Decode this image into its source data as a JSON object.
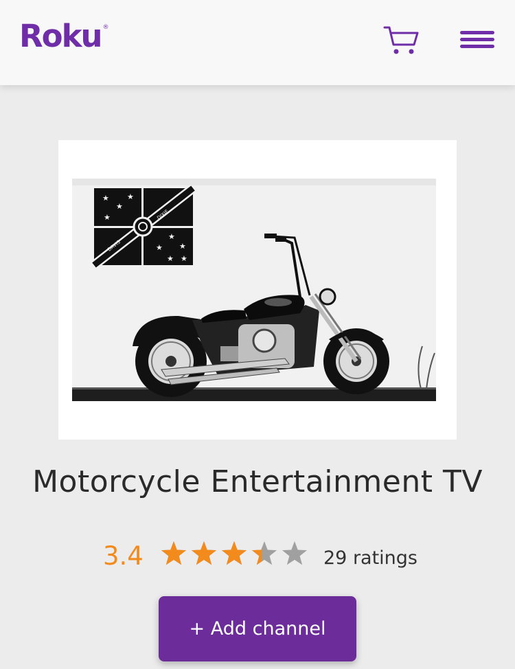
{
  "header": {
    "logo_text": "Roku",
    "logo_mark": "®",
    "cart_icon": "cart-icon",
    "menu_icon": "hamburger-menu-icon"
  },
  "channel": {
    "title": "Motorcycle Entertainment TV",
    "rating_value": "3.4",
    "rating_stars": 3.4,
    "rating_max": 5,
    "ratings_count": "29 ratings",
    "poster_flag_text_left": "DAVIS",
    "poster_flag_text_right": "DIXIE"
  },
  "actions": {
    "add_channel_label": "+ Add channel"
  },
  "colors": {
    "brand_purple": "#6f2da8",
    "button_purple": "#6c2c9a",
    "rating_orange": "#f28a1c",
    "star_gray": "#a0a0a0"
  }
}
